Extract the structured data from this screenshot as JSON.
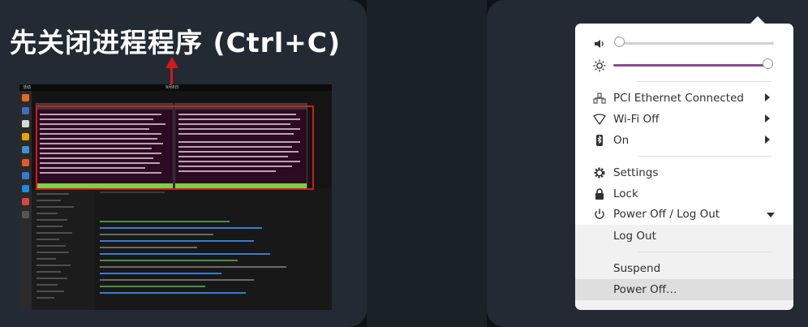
{
  "tutorial": {
    "caption": "先关闭进程程序 (Ctrl+C)"
  },
  "desktop_screenshot": {
    "topbar_left": "活动",
    "topbar_center": "9月8日",
    "terminal_left_title": "终端",
    "terminal_right_title": "终端"
  },
  "system_menu": {
    "volume_level": 0.0,
    "brightness_level": 0.98,
    "network": {
      "label": "PCI Ethernet Connected",
      "icon": "ethernet-icon"
    },
    "wifi": {
      "label": "Wi-Fi Off",
      "icon": "wifi-icon"
    },
    "bluetooth": {
      "label": "On",
      "icon": "bluetooth-icon"
    },
    "settings": {
      "label": "Settings",
      "icon": "gear-icon"
    },
    "lock": {
      "label": "Lock",
      "icon": "lock-icon"
    },
    "power": {
      "label": "Power Off / Log Out",
      "icon": "power-icon"
    },
    "power_submenu": {
      "logout": "Log Out",
      "suspend": "Suspend",
      "poweroff": "Power Off…"
    }
  },
  "colors": {
    "accent_slider": "#8a4a93",
    "highlight_red": "#d21a1a"
  }
}
